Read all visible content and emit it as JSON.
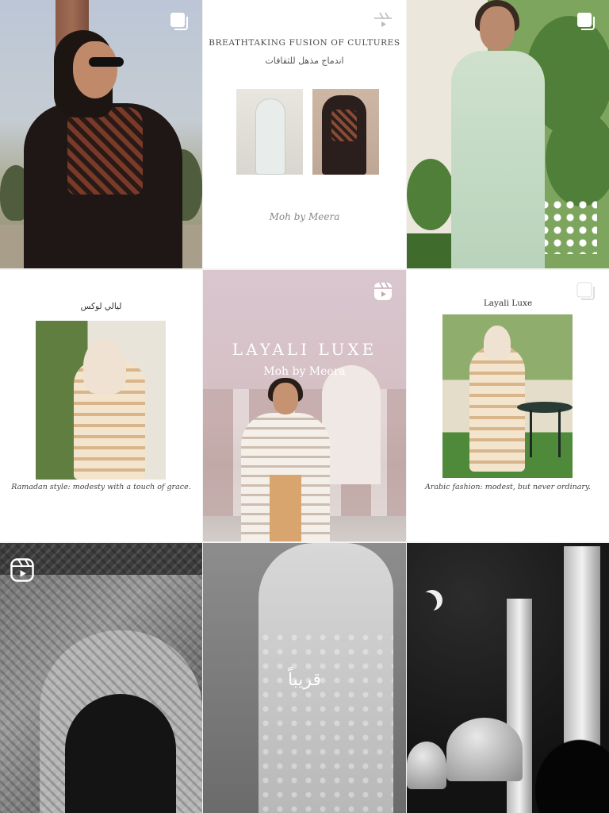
{
  "grid": {
    "posts": [
      {
        "id": "post-1",
        "type": "photo",
        "badge": "multi"
      },
      {
        "id": "post-2",
        "type": "card",
        "badge": "reel",
        "title": "BREATHTAKING FUSION OF CULTURES",
        "subtitle": "اندماج مذهل للثقافات",
        "logo": "Moh by Meera"
      },
      {
        "id": "post-3",
        "type": "photo",
        "badge": "multi"
      },
      {
        "id": "post-4",
        "type": "card",
        "title": "ليالي لوكس",
        "caption": "Ramadan style: modesty with a touch of grace."
      },
      {
        "id": "post-5",
        "type": "reel",
        "badge": "reel",
        "title": "LAYALI LUXE",
        "subtitle": "Moh by Meera"
      },
      {
        "id": "post-6",
        "type": "card",
        "badge": "multi",
        "title": "Layali Luxe",
        "caption": "Arabic fashion: modest, but never ordinary."
      },
      {
        "id": "post-7",
        "type": "reel",
        "badge": "reel"
      },
      {
        "id": "post-8",
        "type": "photo",
        "overlay": "قريباً"
      },
      {
        "id": "post-9",
        "type": "photo"
      }
    ]
  },
  "colors": {
    "badge": "#ffffff",
    "card_bg": "#ffffff",
    "text_dark": "#333333"
  },
  "icons": {
    "multi": "carousel-icon",
    "reel": "reel-icon"
  }
}
